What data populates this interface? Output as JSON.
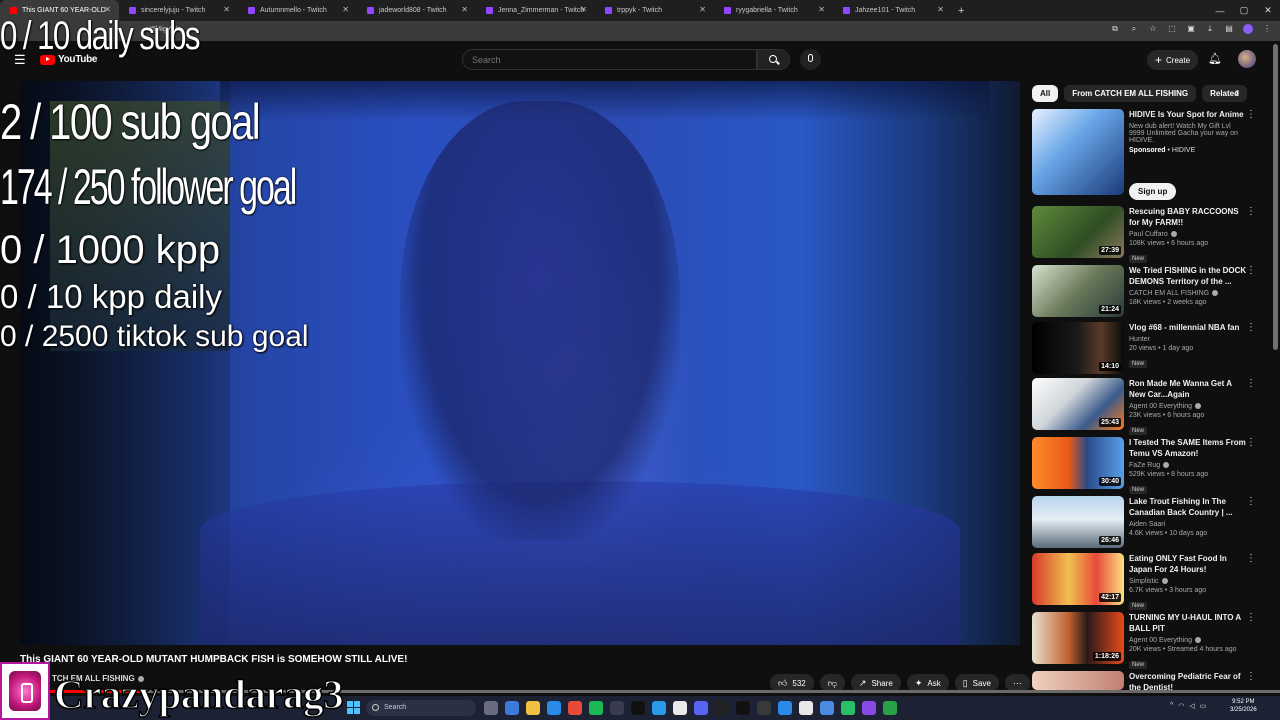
{
  "browser": {
    "tabs": [
      {
        "label": "This GIANT 60 YEAR-OLD"
      },
      {
        "label": "sincerelyjuju - Twitch"
      },
      {
        "label": "Autumnmello - Twitch"
      },
      {
        "label": "jadeworld808 - Twitch"
      },
      {
        "label": "Jenna_Zimmerman - Twitch"
      },
      {
        "label": "trppyk - Twitch"
      },
      {
        "label": "ryygabriella - Twitch"
      },
      {
        "label": "Jahzee101 - Twitch"
      }
    ],
    "url_fragment": "t5l4igyWo"
  },
  "header": {
    "logo_text": "YouTube",
    "search_placeholder": "Search",
    "create_label": "Create"
  },
  "overlay": {
    "daily_subs": "0 / 10 daily subs",
    "sub_goal": "2 / 100 sub goal",
    "follower_goal": "174 / 250 follower goal",
    "kpp": "0 / 1000 kpp",
    "kpp_daily": "0 / 10 kpp daily",
    "tiktok_goal": "0 / 2500 tiktok sub goal"
  },
  "video": {
    "title": "This GIANT 60 YEAR-OLD MUTANT HUMPBACK FISH is SOMEHOW STILL ALIVE!",
    "channel": "TCH EM ALL FISHING",
    "likes": "532",
    "share_label": "Share",
    "ask_label": "Ask",
    "save_label": "Save"
  },
  "watermark": {
    "name": "Crazypandarag3"
  },
  "sidebar": {
    "chips": [
      "All",
      "From CATCH EM ALL FISHING",
      "Related"
    ],
    "sponsored": {
      "title": "HIDIVE Is Your Spot for Anime",
      "description": "New dub alert! Watch My Gift Lvl 9999 Unlimited Gacha your way on HIDIVE.",
      "sponsor_label": "Sponsored",
      "sponsor_name": "HIDIVE",
      "cta": "Sign up"
    },
    "items": [
      {
        "title": "Rescuing BABY RACCOONS for My FARM!!",
        "channel": "Paul Cuffaro",
        "stats": "108K views • 6 hours ago",
        "badge": "New",
        "duration": "27:39"
      },
      {
        "title": "We Tried FISHING in the DOCK DEMONS Territory of the ...",
        "channel": "CATCH EM ALL FISHING",
        "stats": "18K views • 2 weeks ago",
        "badge": "",
        "duration": "21:24"
      },
      {
        "title": "Vlog #68 - millennial NBA fan",
        "channel": "Hunter",
        "stats": "20 views • 1 day ago",
        "badge": "New",
        "duration": "14:10"
      },
      {
        "title": "Ron Made Me Wanna Get A New Car...Again",
        "channel": "Agent 00 Everything",
        "stats": "23K views • 6 hours ago",
        "badge": "New",
        "duration": "25:43"
      },
      {
        "title": "I Tested The SAME Items From Temu VS Amazon!",
        "channel": "FaZe Rug",
        "stats": "529K views • 8 hours ago",
        "badge": "New",
        "duration": "30:40"
      },
      {
        "title": "Lake Trout Fishing In The Canadian Back Country | ...",
        "channel": "Aiden Saari",
        "stats": "4.6K views • 10 days ago",
        "badge": "",
        "duration": "26:46"
      },
      {
        "title": "Eating ONLY Fast Food In Japan For 24 Hours!",
        "channel": "Simplistic",
        "stats": "6.7K views • 3 hours ago",
        "badge": "New",
        "duration": "42:17"
      },
      {
        "title": "TURNING MY U-HAUL INTO A BALL PIT",
        "channel": "Agent 00 Everything",
        "stats": "20K views • Streamed 4 hours ago",
        "badge": "New",
        "duration": "1:18:26"
      },
      {
        "title": "Overcoming Pediatric Fear of the Dentist!",
        "channel": "",
        "stats": "",
        "badge": "",
        "duration": ""
      }
    ]
  },
  "taskbar": {
    "search_label": "Search",
    "time": "9:52 PM",
    "date": "3/25/2026"
  },
  "colors": {
    "yt_red": "#ff0000",
    "twitch_purple": "#9146ff",
    "windows_blue": "#4cc2ff"
  }
}
